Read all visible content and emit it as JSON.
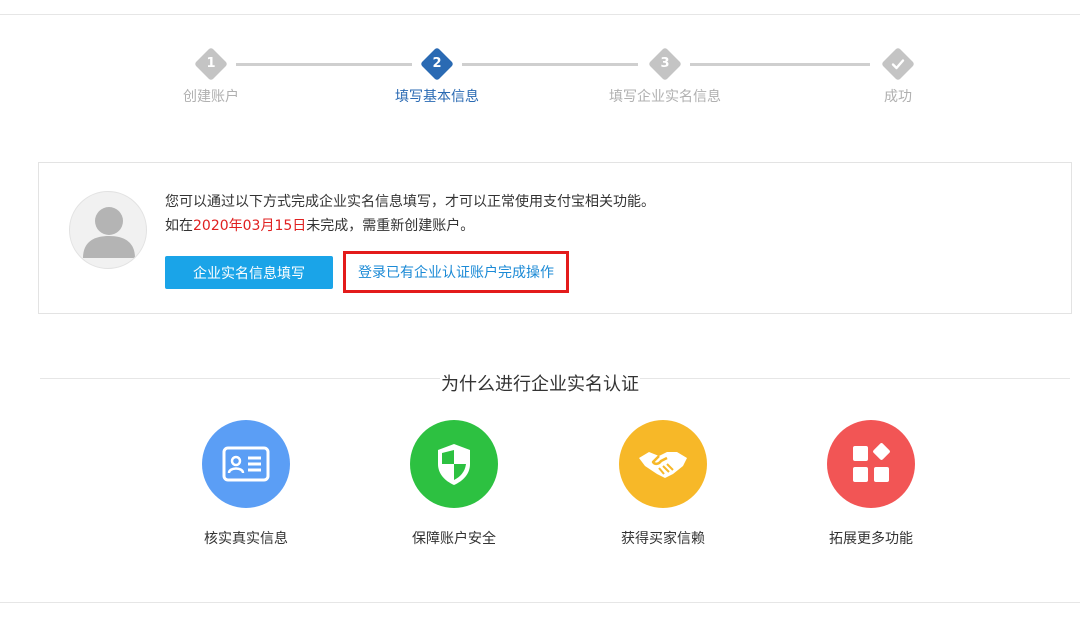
{
  "steps": [
    {
      "num": "1",
      "label": "创建账户",
      "state": "done"
    },
    {
      "num": "2",
      "label": "填写基本信息",
      "state": "active"
    },
    {
      "num": "3",
      "label": "填写企业实名信息",
      "state": "todo"
    },
    {
      "num": "",
      "label": "成功",
      "state": "todo",
      "icon": "check-icon"
    }
  ],
  "card": {
    "line1": "您可以通过以下方式完成企业实名信息填写，才可以正常使用支付宝相关功能。",
    "line2_prefix": "如在",
    "deadline": "2020年03月15日",
    "line2_suffix": "未完成，需重新创建账户。",
    "fill_button": "企业实名信息填写",
    "login_link": "登录已有企业认证账户完成操作"
  },
  "why": {
    "title": "为什么进行企业实名认证",
    "features": [
      {
        "label": "核实真实信息",
        "icon": "id-card-icon",
        "color": "#5b9ef5"
      },
      {
        "label": "保障账户安全",
        "icon": "shield-icon",
        "color": "#2dc141"
      },
      {
        "label": "获得买家信赖",
        "icon": "handshake-icon",
        "color": "#f7b828"
      },
      {
        "label": "拓展更多功能",
        "icon": "apps-grid-icon",
        "color": "#f25555"
      }
    ]
  },
  "colors": {
    "accent": "#2a6ab3",
    "button": "#1aa4e8",
    "link": "#1b8ad6",
    "highlight_border": "#e31b1b",
    "deadline": "#e02020"
  }
}
